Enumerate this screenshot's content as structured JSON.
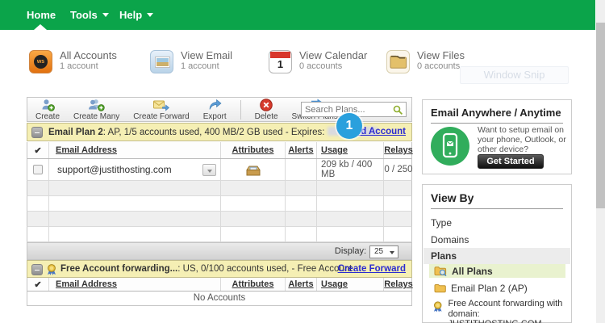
{
  "nav": {
    "home": "Home",
    "tools": "Tools",
    "help": "Help"
  },
  "summary": {
    "all_accounts": {
      "title": "All Accounts",
      "count": "1 account",
      "logo": "ws"
    },
    "view_email": {
      "title": "View Email",
      "count": "1 account"
    },
    "view_calendar": {
      "title": "View Calendar",
      "count": "0 accounts",
      "day": "1"
    },
    "view_files": {
      "title": "View Files",
      "count": "0 accounts"
    }
  },
  "ghost_button": "Window Snip",
  "toolbar": {
    "create": "Create",
    "create_many": "Create Many",
    "create_forward": "Create Forward",
    "export": "Export",
    "delete": "Delete",
    "switch_plans": "Switch Plans",
    "search_placeholder": "Search Plans..."
  },
  "plan_banner": {
    "title": "Email Plan 2",
    "details": ": AP, 1/5 accounts used, 400 MB/2 GB used - Expires:",
    "add_account_link": "Add Account",
    "step_badge": "1"
  },
  "table_headers": {
    "check": "✔",
    "email": "Email Address",
    "attributes": "Attributes",
    "alerts": "Alerts",
    "usage": "Usage",
    "relays": "Relays"
  },
  "accounts_table": {
    "row": {
      "email": "support@justithosting.com",
      "usage": "209 kb / 400 MB",
      "relays": "0 / 250"
    },
    "display_label": "Display:",
    "display_value": "25"
  },
  "forward_banner": {
    "title": "Free Account forwarding...",
    "details": ": US, 0/100 accounts used, - Free Account",
    "create_forward_link": "Create Forward"
  },
  "forward_table": {
    "empty_text": "No Accounts"
  },
  "sidebar": {
    "promo": {
      "title": "Email Anywhere / Anytime",
      "line1": "Want to setup email on",
      "line2": "your phone, Outlook, or",
      "line3": "other device?",
      "button": "Get Started"
    },
    "view_by": {
      "title": "View By",
      "type": "Type",
      "domains": "Domains",
      "plans": "Plans",
      "all_plans": "All Plans",
      "plan2": "Email Plan 2 (AP)",
      "forward_line1": "Free Account forwarding with",
      "forward_line2": "domain: JUSTITHOSTING.COM"
    }
  },
  "colors": {
    "nav_green": "#0ba44a",
    "banner_yellow": "#f5efb4",
    "badge_blue": "#2aa0dd",
    "link_blue": "#2b2bd0",
    "highlight_green": "#e9f2cf",
    "promo_green": "#31ad5c"
  }
}
